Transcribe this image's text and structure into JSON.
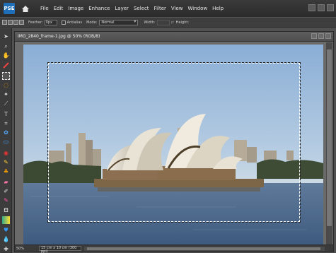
{
  "app": {
    "logo_text": "PSE",
    "brand_color": "#1f6fb8"
  },
  "menu": {
    "items": [
      "File",
      "Edit",
      "Image",
      "Enhance",
      "Layer",
      "Select",
      "Filter",
      "View",
      "Window",
      "Help"
    ]
  },
  "options": {
    "feather_label": "Feather:",
    "feather_value": "0px",
    "antialias_label": "Antialias",
    "mode_label": "Mode:",
    "mode_value": "Normal",
    "width_label": "Width:",
    "height_label": "Height:"
  },
  "document": {
    "title": "IMG_2840_frame-1.jpg @ 50% (RGB/8)",
    "zoom": "50%",
    "info": "15 cm x 10 cm (300 ppi)"
  },
  "tools": [
    "move-icon",
    "zoom-icon",
    "hand-icon",
    "eyedropper-icon",
    "marquee-icon",
    "lasso-icon",
    "magic-wand-icon",
    "quick-selection-icon",
    "type-icon",
    "crop-icon",
    "cookie-cutter-icon",
    "straighten-icon",
    "red-eye-icon",
    "spot-healing-icon",
    "clone-stamp-icon",
    "eraser-icon",
    "brush-icon",
    "smart-brush-icon",
    "paint-bucket-icon",
    "gradient-icon",
    "shape-icon",
    "blur-icon",
    "sponge-icon"
  ]
}
